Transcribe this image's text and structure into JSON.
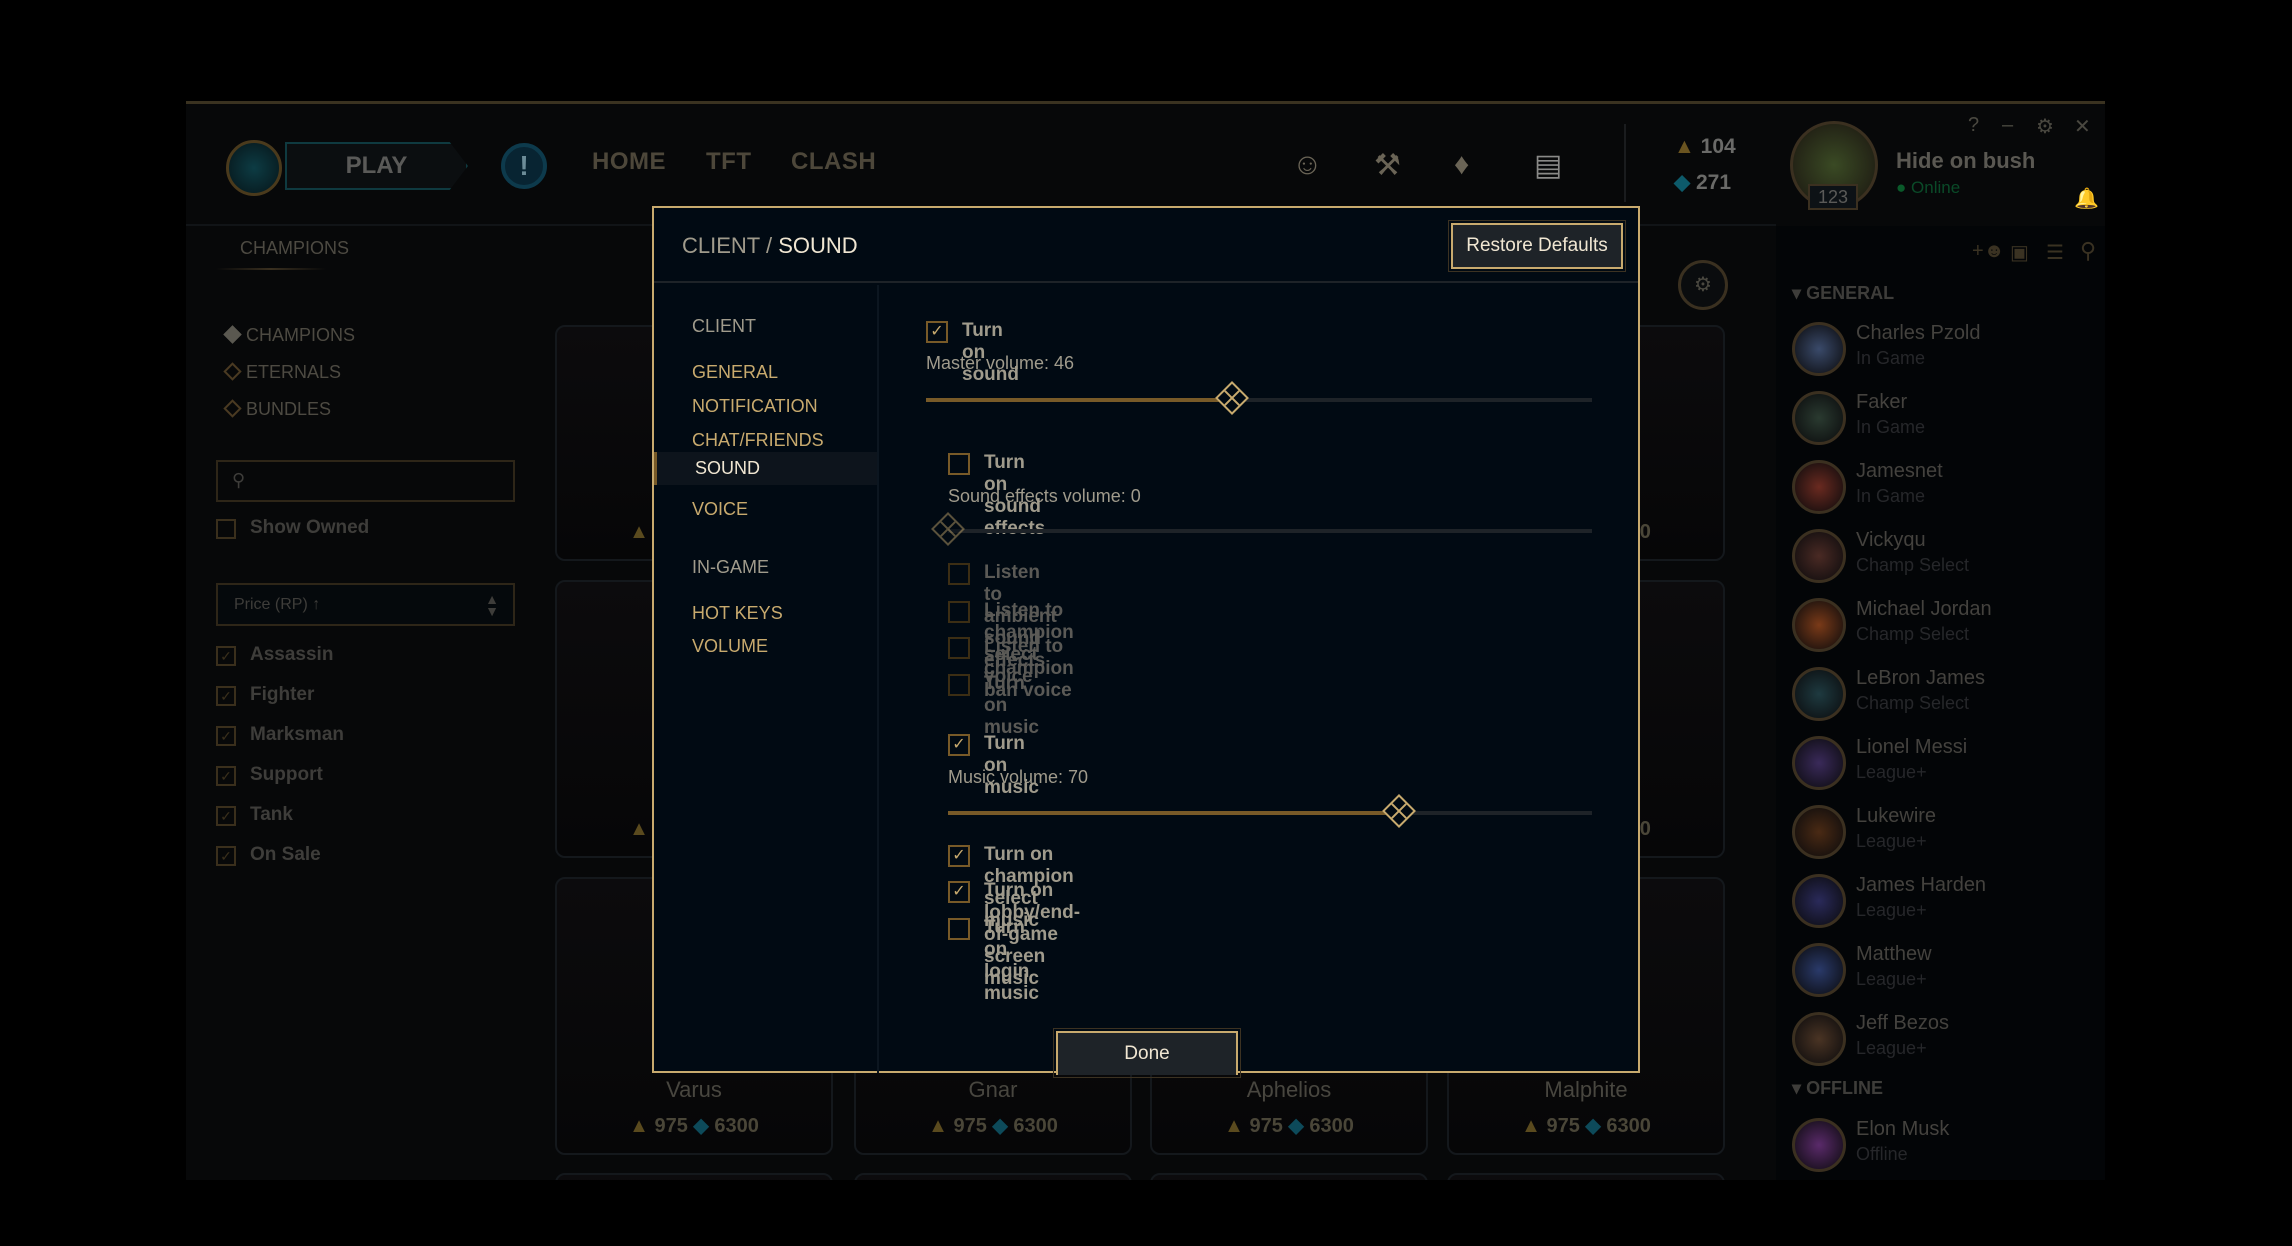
{
  "topnav": {
    "play": "PLAY",
    "links": [
      "HOME",
      "TFT",
      "CLASH"
    ],
    "rp": "104",
    "be": "271"
  },
  "profile": {
    "name": "Hide on bush",
    "status": "Online",
    "level": "123"
  },
  "window_controls": {
    "help": "?",
    "minimize": "–",
    "settings": "⚙",
    "close": "✕"
  },
  "store": {
    "tab": "CHAMPIONS",
    "menu": [
      "CHAMPIONS",
      "ETERNALS",
      "BUNDLES"
    ],
    "search_placeholder": "",
    "show_owned": "Show Owned",
    "sort": "Price (RP) ↑",
    "filters": [
      {
        "label": "Assassin",
        "checked": true
      },
      {
        "label": "Fighter",
        "checked": true
      },
      {
        "label": "Marksman",
        "checked": true
      },
      {
        "label": "Support",
        "checked": true
      },
      {
        "label": "Tank",
        "checked": true
      },
      {
        "label": "On Sale",
        "checked": true
      }
    ],
    "cards": [
      {
        "name": "Varus",
        "rp": "975",
        "be": "6300"
      },
      {
        "name": "Gnar",
        "rp": "975",
        "be": "6300"
      },
      {
        "name": "Aphelios",
        "rp": "975",
        "be": "6300"
      },
      {
        "name": "Malphite",
        "rp": "975",
        "be": "6300"
      }
    ],
    "hidden_card_prices": {
      "rp": "975",
      "be": "6300"
    }
  },
  "social": {
    "groups": [
      {
        "label": "GENERAL"
      },
      {
        "label": "OFFLINE"
      }
    ],
    "friends": [
      {
        "name": "Charles Pzold",
        "status": "In Game",
        "color": "#3a4a6a"
      },
      {
        "name": "Faker",
        "status": "In Game",
        "color": "#2a3a30"
      },
      {
        "name": "Jamesnet",
        "status": "In Game",
        "color": "#6a2a20"
      },
      {
        "name": "Vickyqu",
        "status": "Champ Select",
        "color": "#4a2a24"
      },
      {
        "name": "Michael Jordan",
        "status": "Champ Select",
        "color": "#7a3a18"
      },
      {
        "name": "LeBron James",
        "status": "Champ Select",
        "color": "#1e3a40"
      },
      {
        "name": "Lionel Messi",
        "status": "League+",
        "color": "#3a2a5a"
      },
      {
        "name": "Lukewire",
        "status": "League+",
        "color": "#4a2a14"
      },
      {
        "name": "James Harden",
        "status": "League+",
        "color": "#2a2a5a"
      },
      {
        "name": "Matthew",
        "status": "League+",
        "color": "#2a3a6a"
      },
      {
        "name": "Jeff Bezos",
        "status": "League+",
        "color": "#4a3424"
      }
    ],
    "offline": [
      {
        "name": "Elon Musk",
        "status": "Offline",
        "color": "#5a2a6a"
      }
    ]
  },
  "modal": {
    "breadcrumb_parent": "CLIENT / ",
    "breadcrumb_current": "SOUND",
    "restore": "Restore Defaults",
    "done": "Done",
    "nav": [
      {
        "label": "CLIENT",
        "type": "header"
      },
      {
        "label": "GENERAL"
      },
      {
        "label": "NOTIFICATION"
      },
      {
        "label": "CHAT/FRIENDS"
      },
      {
        "label": "SOUND",
        "selected": true
      },
      {
        "label": "VOICE"
      },
      {
        "label": "IN-GAME",
        "type": "header"
      },
      {
        "label": "HOT KEYS"
      },
      {
        "label": "VOLUME"
      }
    ],
    "sound": {
      "label": "Turn on sound",
      "checked": true,
      "volume_label": "Master volume: 46",
      "volume": 46
    },
    "effects": {
      "label": "Turn on sound effects",
      "checked": false,
      "volume_label": "Sound effects volume: 0",
      "volume": 0
    },
    "disabled_options": [
      {
        "label": "Listen to ambient sound effects",
        "checked": false
      },
      {
        "label": "Listen to champion select voice",
        "checked": false
      },
      {
        "label": "Listen to champion ban voice",
        "checked": false
      },
      {
        "label": "Turn on music",
        "checked": false
      }
    ],
    "music": {
      "label": "Turn on music",
      "checked": true,
      "volume_label": "Music volume: 70",
      "volume": 70
    },
    "music_options": [
      {
        "label": "Turn on champion select music",
        "checked": true
      },
      {
        "label": "Turn on lobby/end-of-game screen music",
        "checked": true
      },
      {
        "label": "Turn on login music",
        "checked": false
      }
    ]
  },
  "colors": {
    "gold": "#c8aa6e",
    "modal_bg": "#010a13",
    "text": "#a09b8c",
    "online": "#0acb6a"
  }
}
